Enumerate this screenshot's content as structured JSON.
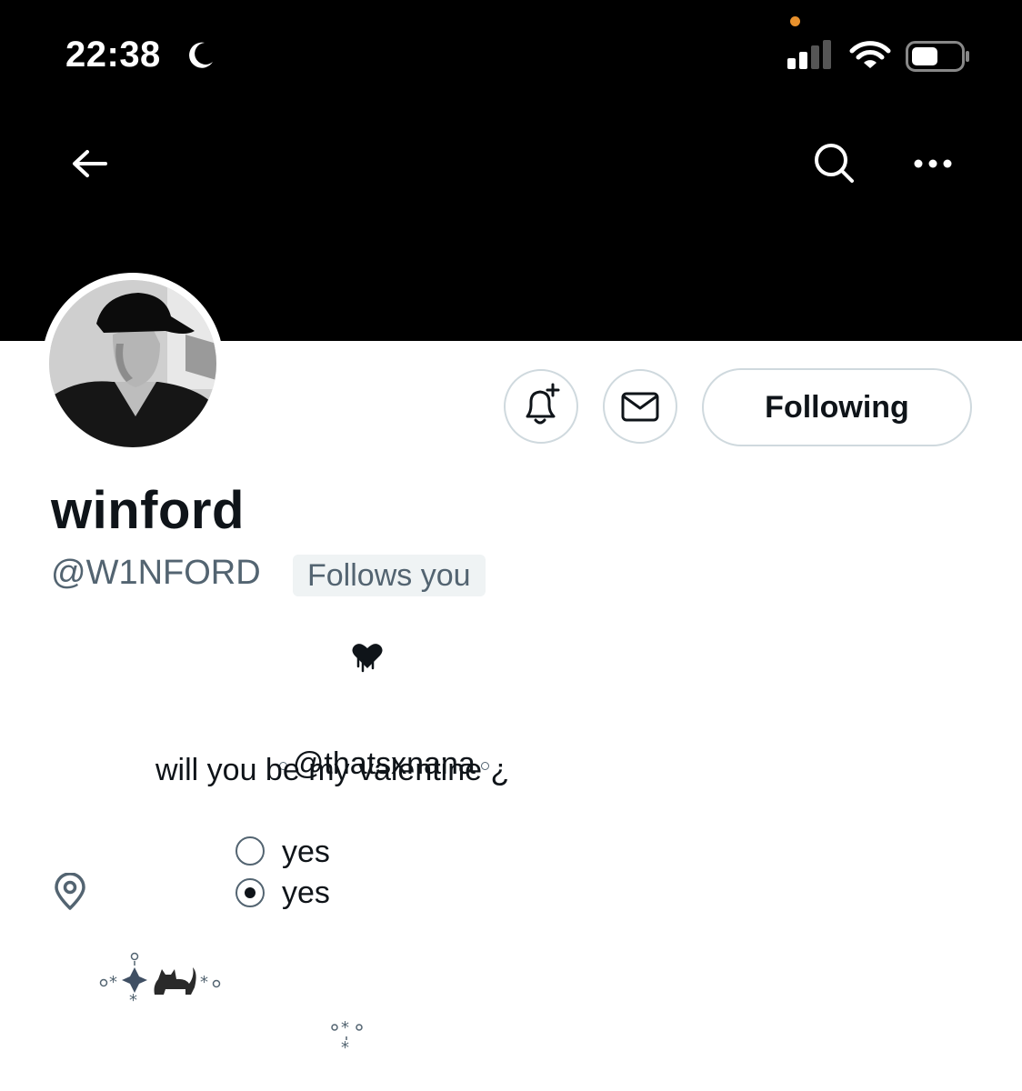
{
  "status_bar": {
    "time": "22:38"
  },
  "profile": {
    "display_name": "winford",
    "handle": "@W1NFORD",
    "follows_you_badge": "Follows you",
    "following_button": "Following"
  },
  "bio": {
    "mention": "@thatsxnana",
    "question": "will you be my valentine ¿",
    "options": [
      {
        "label": "yes",
        "selected": false
      },
      {
        "label": "yes",
        "selected": true
      }
    ],
    "deco_star": "*"
  },
  "icons": {
    "back": "arrow-left-icon",
    "search": "search-icon",
    "more": "more-horizontal-icon",
    "notify": "bell-plus-icon",
    "message": "envelope-icon",
    "location": "location-pin-icon"
  },
  "colors": {
    "banner": "#000000",
    "text_primary": "#0f1419",
    "text_secondary": "#536471",
    "border": "#cfd9de",
    "badge_bg": "#eff3f4",
    "recording_dot": "#e8912d"
  }
}
